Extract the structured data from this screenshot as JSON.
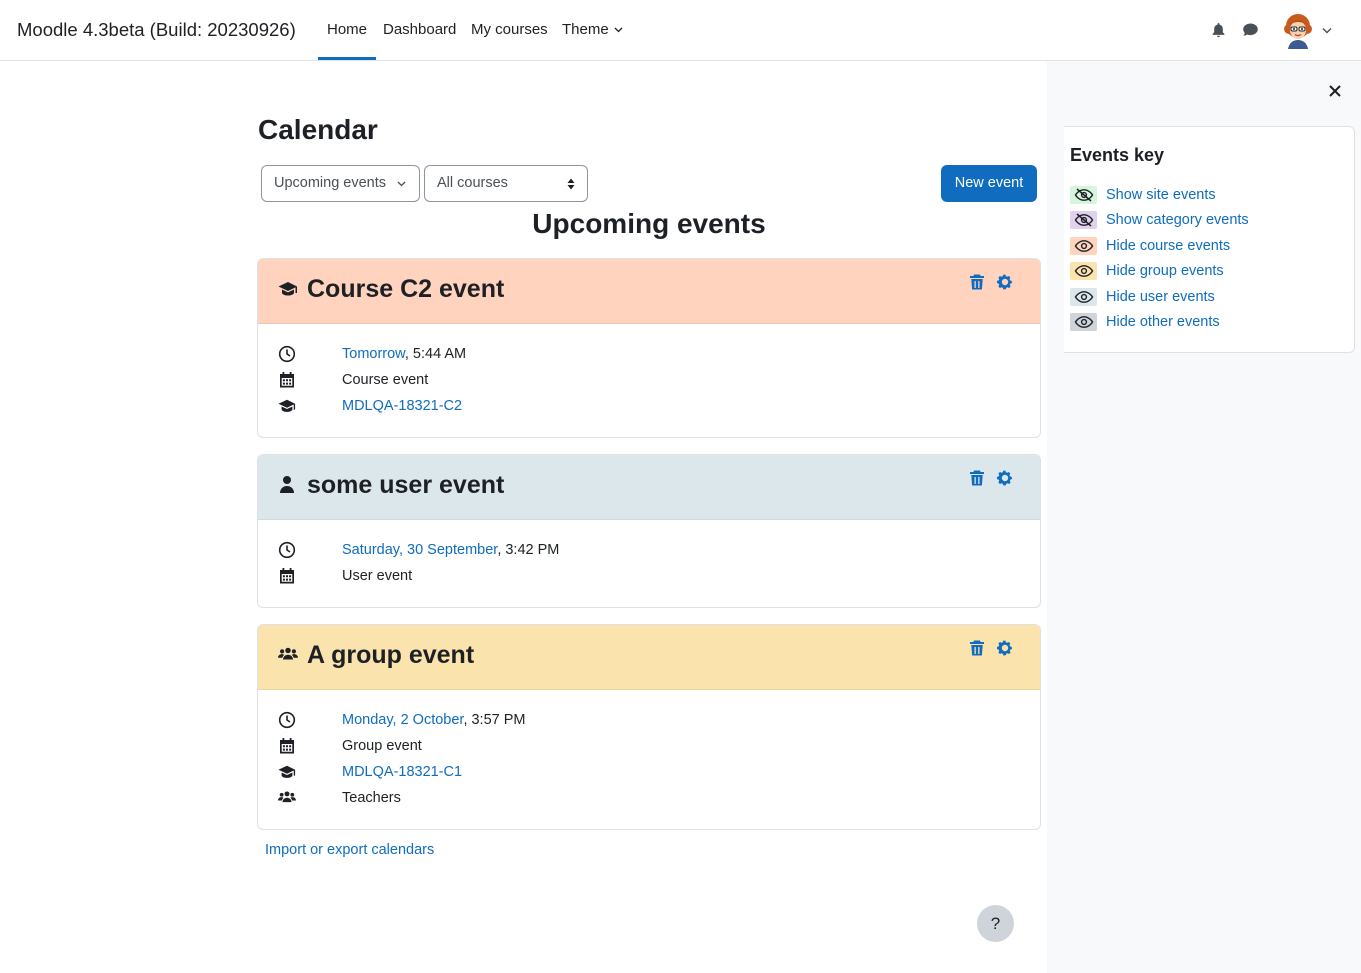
{
  "navbar": {
    "brand": "Moodle 4.3beta (Build: 20230926)",
    "items": [
      {
        "label": "Home",
        "active": true
      },
      {
        "label": "Dashboard"
      },
      {
        "label": "My courses"
      },
      {
        "label": "Theme",
        "has_dropdown": true
      }
    ],
    "icons": [
      "bell-icon",
      "chat-icon"
    ],
    "user_menu": "avatar"
  },
  "page": {
    "title": "Calendar",
    "view_select": "Upcoming events",
    "course_select": "All courses",
    "new_event_label": "New event",
    "section_heading": "Upcoming events",
    "import_link": "Import or export calendars",
    "help_label": "?"
  },
  "events": [
    {
      "title": "Course C2 event",
      "type_icon": "graduation-cap-icon",
      "header_color": "#ffd3bd",
      "date_link": "Tomorrow",
      "time": ", 5:44 AM",
      "event_type": "Course event",
      "course_link": "MDLQA-18321-C2"
    },
    {
      "title": "some user event",
      "type_icon": "user-icon",
      "header_color": "#dce7ec",
      "date_link": "Saturday, 30 September",
      "time": ", 3:42 PM",
      "event_type": "User event"
    },
    {
      "title": "A group event",
      "type_icon": "users-icon",
      "header_color": "#fbe3ae",
      "date_link": "Monday, 2 October",
      "time": ", 3:57 PM",
      "event_type": "Group event",
      "course_link": "MDLQA-18321-C1",
      "group": "Teachers"
    }
  ],
  "events_key": {
    "title": "Events key",
    "items": [
      {
        "label": "Show site events",
        "color": "#d7f4dd",
        "icon": "eye-slash-icon"
      },
      {
        "label": "Show category events",
        "color": "#e2d1ec",
        "icon": "eye-slash-icon"
      },
      {
        "label": "Hide course events",
        "color": "#ffd3bd",
        "icon": "eye-icon"
      },
      {
        "label": "Hide group events",
        "color": "#fbe3ae",
        "icon": "eye-icon"
      },
      {
        "label": "Hide user events",
        "color": "#dce7ec",
        "icon": "eye-icon"
      },
      {
        "label": "Hide other events",
        "color": "#ced4da",
        "icon": "eye-icon"
      }
    ]
  },
  "colors": {
    "primary": "#0f6cbf",
    "text": "#1d2125",
    "drawer_bg": "#f8f9fa"
  }
}
